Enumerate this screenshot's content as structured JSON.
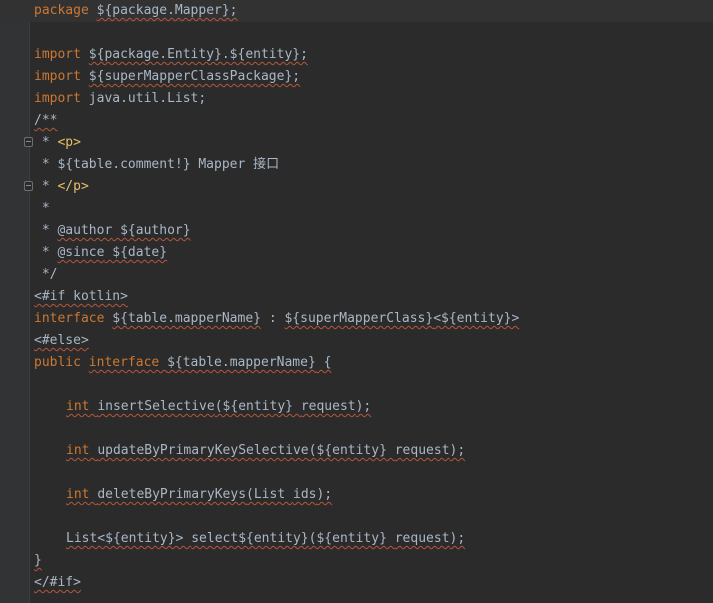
{
  "editor": {
    "lines": [
      {
        "parts": [
          "package ",
          "${package.Mapper};"
        ]
      },
      {
        "parts": [
          ""
        ]
      },
      {
        "parts": [
          "import ",
          "${package.Entity}.${entity};"
        ]
      },
      {
        "parts": [
          "import ",
          "${superMapperClassPackage};"
        ]
      },
      {
        "parts": [
          "import ",
          "java.util.List;"
        ]
      },
      {
        "parts": [
          "/**"
        ]
      },
      {
        "parts": [
          " * ",
          "<p>"
        ]
      },
      {
        "parts": [
          " * ${table.comment!} Mapper 接口"
        ]
      },
      {
        "parts": [
          " * ",
          "</p>"
        ]
      },
      {
        "parts": [
          " *"
        ]
      },
      {
        "parts": [
          " * ",
          "@author",
          " ${author}"
        ]
      },
      {
        "parts": [
          " * ",
          "@since",
          " ${date}"
        ]
      },
      {
        "parts": [
          " */"
        ]
      },
      {
        "parts": [
          "<#if kotlin>"
        ]
      },
      {
        "parts": [
          "interface ",
          "${table.mapperName}",
          " : ",
          "${superMapperClass}",
          "<${entity}>"
        ]
      },
      {
        "parts": [
          "<#else>"
        ]
      },
      {
        "parts": [
          "public ",
          "interface ",
          "${table.mapperName}",
          " {"
        ]
      },
      {
        "parts": [
          ""
        ]
      },
      {
        "parts": [
          "int ",
          "insertSelective",
          "(${entity} ",
          "request",
          ");"
        ]
      },
      {
        "parts": [
          ""
        ]
      },
      {
        "parts": [
          "int ",
          "updateByPrimaryKeySelective",
          "(${entity} ",
          "request",
          ");"
        ]
      },
      {
        "parts": [
          ""
        ]
      },
      {
        "parts": [
          "int ",
          "deleteByPrimaryKeys",
          "(List ",
          "ids",
          ");"
        ]
      },
      {
        "parts": [
          ""
        ]
      },
      {
        "parts": [
          "List<${entity}> ",
          "select${entity}",
          "(${entity} ",
          "request",
          ");"
        ]
      },
      {
        "parts": [
          "}"
        ]
      },
      {
        "parts": [
          "</#if>"
        ]
      }
    ]
  }
}
